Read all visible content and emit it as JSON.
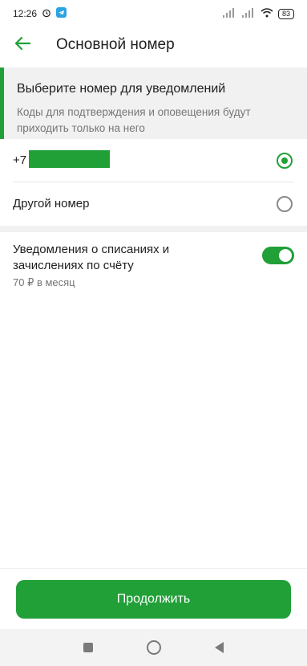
{
  "statusbar": {
    "time": "12:26",
    "battery": "83"
  },
  "appbar": {
    "title": "Основной номер"
  },
  "info": {
    "title": "Выберите номер для уведомлений",
    "text": "Коды для подтверждения и оповещения будут приходить только на него"
  },
  "options": {
    "phone_prefix": "+7",
    "other_label": "Другой номер",
    "selected": "phone"
  },
  "notifications": {
    "title": "Уведомления о списаниях и зачислениях по счёту",
    "price": "70 ₽ в месяц",
    "enabled": true
  },
  "footer": {
    "continue_label": "Продолжить"
  },
  "colors": {
    "accent": "#21a038",
    "muted_text": "#767676",
    "section_bg": "#f1f1f1"
  }
}
